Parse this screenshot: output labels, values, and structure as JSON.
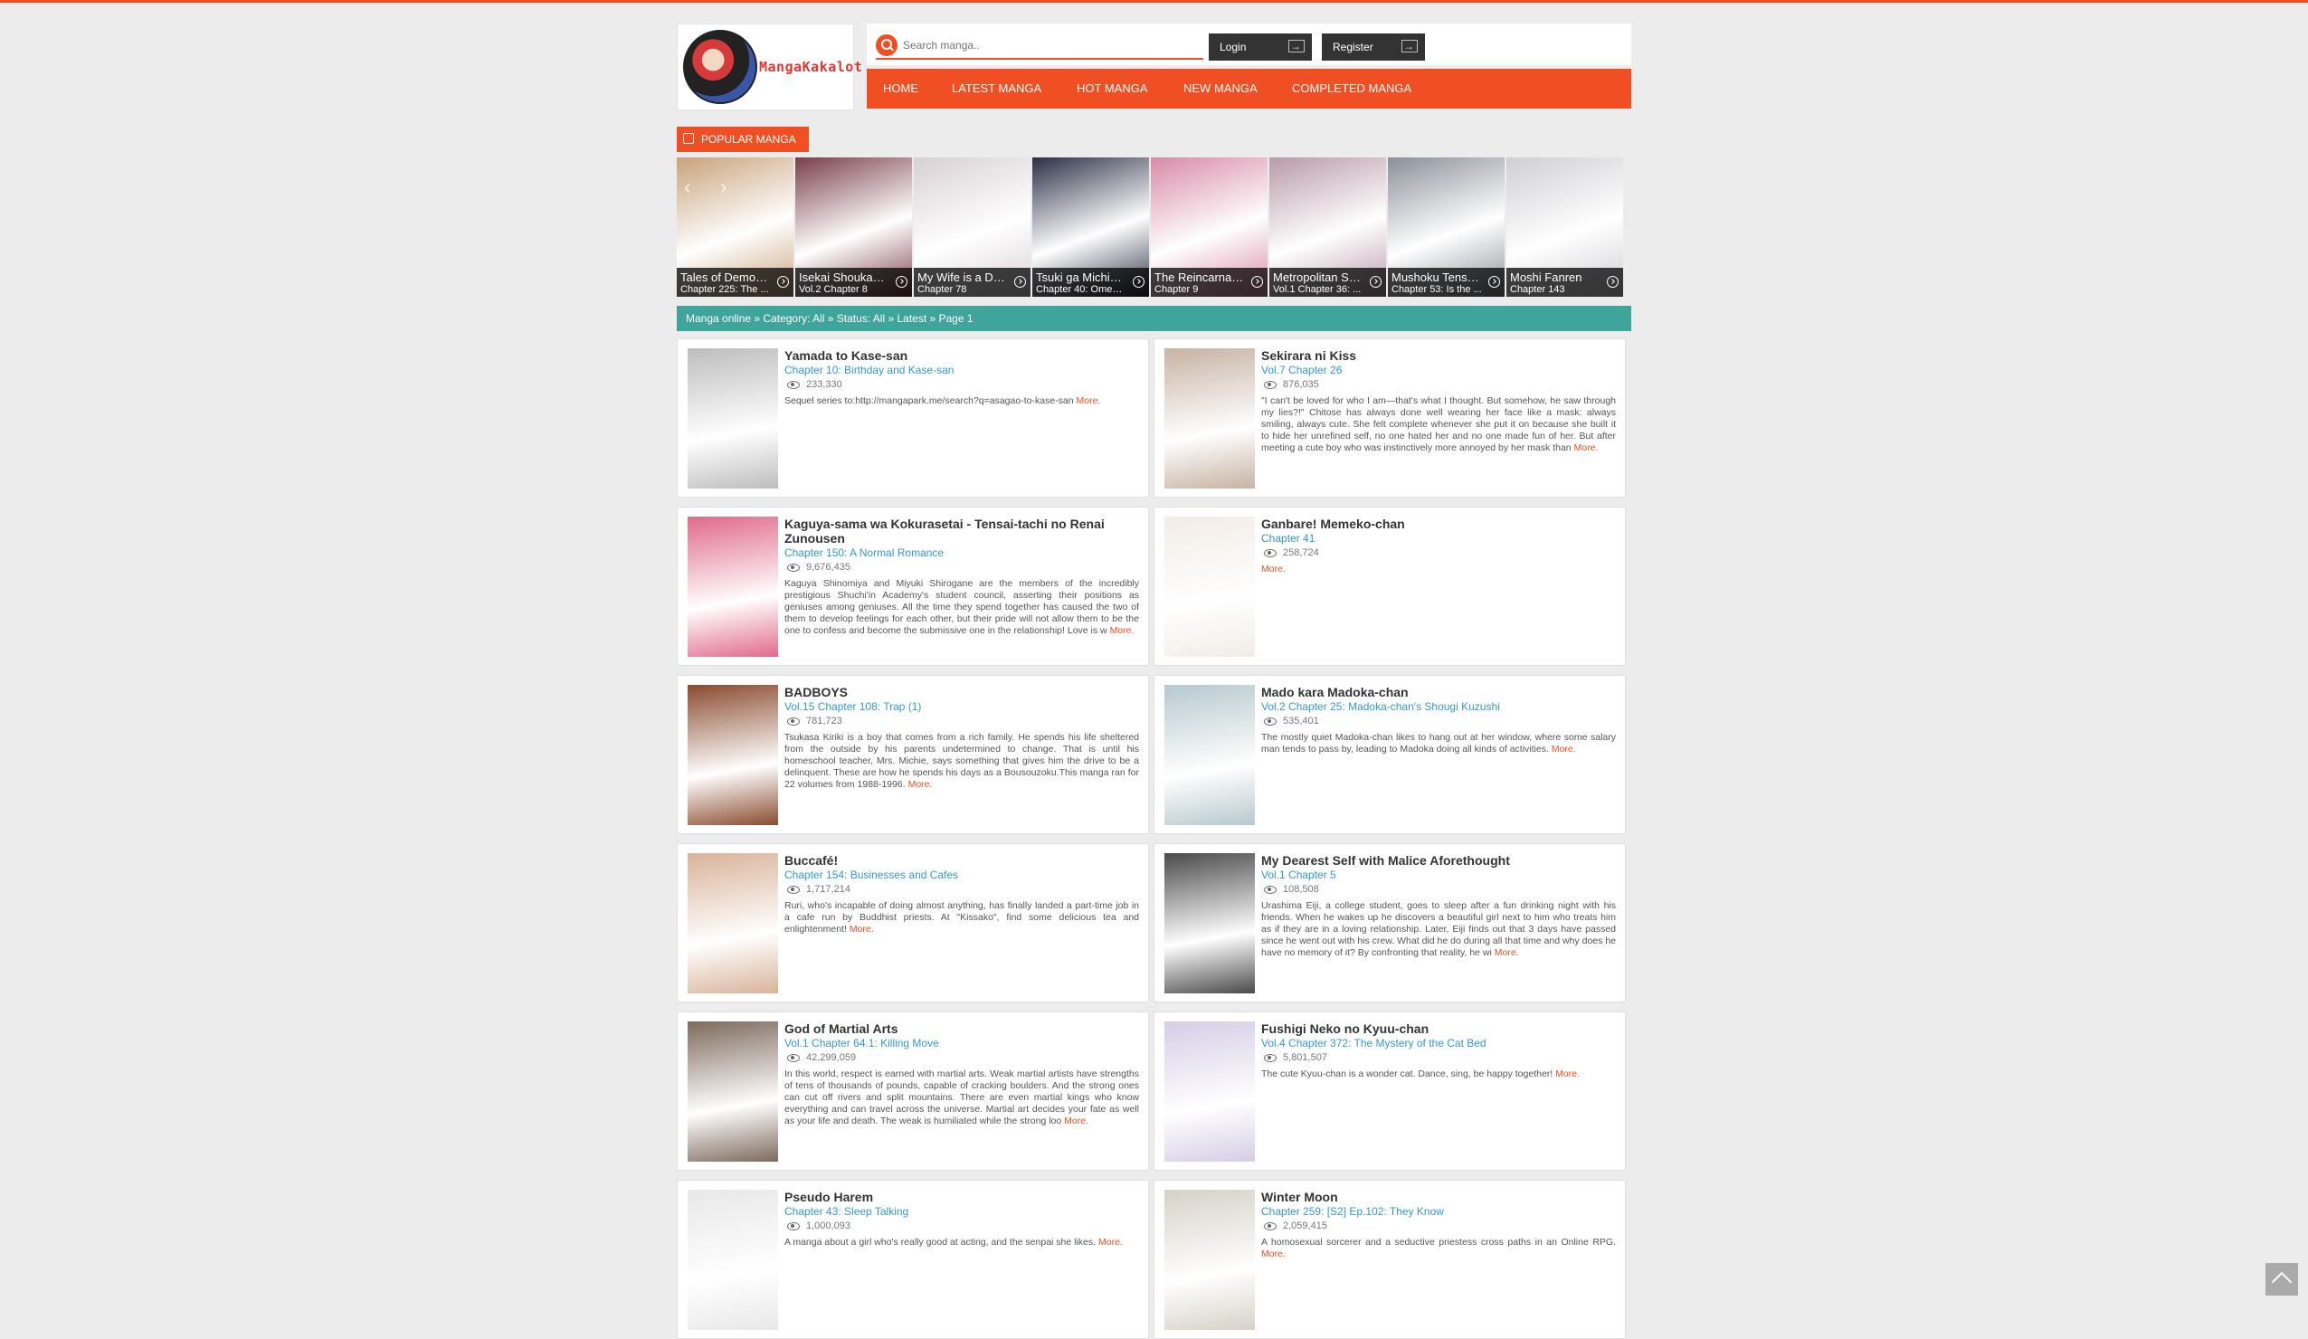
{
  "logo": {
    "text": "MangaKakalot"
  },
  "search": {
    "placeholder": "Search manga.."
  },
  "auth": {
    "login": "Login",
    "register": "Register"
  },
  "nav": [
    "HOME",
    "LATEST MANGA",
    "HOT MANGA",
    "NEW MANGA",
    "COMPLETED MANGA"
  ],
  "popular": {
    "title": "POPULAR MANGA",
    "items": [
      {
        "title": "Tales of Demon...",
        "chapter": "Chapter 225: The ...",
        "color": "#c9a27a"
      },
      {
        "title": "Isekai Shoukan ...",
        "chapter": "Vol.2 Chapter 8",
        "color": "#7a3f4a"
      },
      {
        "title": "My Wife is a De...",
        "chapter": "Chapter 78",
        "color": "#d8d0d4"
      },
      {
        "title": "Tsuki ga Michibi...",
        "chapter": "Chapter 40: Omen ...",
        "color": "#2b2f45"
      },
      {
        "title": "The Reincarnati...",
        "chapter": "Chapter 9",
        "color": "#d88aa6"
      },
      {
        "title": "Metropolitan Sy...",
        "chapter": "Vol.1 Chapter 36: ...",
        "color": "#b89aa8"
      },
      {
        "title": "Mushoku Tensei:...",
        "chapter": "Chapter 53: Is the ...",
        "color": "#8a8f99"
      },
      {
        "title": "Moshi Fanren",
        "chapter": "Chapter 143",
        "color": "#cfcfd4"
      }
    ]
  },
  "breadcrumb": "Manga online » Category: All » Status: All » Latest » Page 1",
  "manga": [
    {
      "title": "Yamada to Kase-san",
      "chapter": "Chapter 10: Birthday and Kase-san",
      "views": "233,330",
      "desc": "Sequel series to:http://mangapark.me/search?q=asagao-to-kase-san",
      "more": "More.",
      "cover": "#bdbdbd"
    },
    {
      "title": "Sekirara ni Kiss",
      "chapter": "Vol.7 Chapter 26",
      "views": "876,035",
      "desc": "\"I can't be loved for who I am—that's what I thought. But somehow, he saw through my lies?!\" Chitose has always done well wearing her face like a mask: always smiling, always cute. She felt complete whenever she put it on because she built it to hide her unrefined self, no one hated her and no one made fun of her. But after meeting a cute boy who was instinctively more annoyed by her mask than",
      "more": "More.",
      "cover": "#c7b3a3"
    },
    {
      "title": "Kaguya-sama wa Kokurasetai - Tensai-tachi no Renai Zunousen",
      "chapter": "Chapter 150: A Normal Romance",
      "views": "9,676,435",
      "desc": "Kaguya Shinomiya and Miyuki Shirogane are the members of the incredibly prestigious Shuchi'in Academy's student council, asserting their positions as geniuses among geniuses. All the time they spend together has caused the two of them to develop feelings for each other, but their pride will not allow them to be the one to confess and become the submissive one in the relationship! Love is w",
      "more": "More.",
      "cover": "#e06a8a"
    },
    {
      "title": "Ganbare! Memeko-chan",
      "chapter": "Chapter 41",
      "views": "258,724",
      "desc": "",
      "more": "More.",
      "cover": "#f2ece6"
    },
    {
      "title": "BADBOYS",
      "chapter": "Vol.15 Chapter 108: Trap (1)",
      "views": "781,723",
      "desc": "Tsukasa Kiriki is a boy that comes from a rich family. He spends his life sheltered from the outside by his parents undetermined to change. That is until his homeschool teacher, Mrs. Michie, says something that gives him the drive to be a delinquent. These are how he spends his days as a Bousouzoku.This manga ran for 22 volumes from 1988-1996.",
      "more": "More.",
      "cover": "#8a4b2f"
    },
    {
      "title": "Mado kara Madoka-chan",
      "chapter": "Vol.2 Chapter 25: Madoka-chan's Shougi Kuzushi",
      "views": "535,401",
      "desc": "The mostly quiet Madoka-chan likes to hang out at her window, where some salary man tends to pass by, leading to Madoka doing all kinds of activities.",
      "more": "More.",
      "cover": "#b7c9cf"
    },
    {
      "title": "Buccafé!",
      "chapter": "Chapter 154: Businesses and Cafes",
      "views": "1,717,214",
      "desc": "Ruri, who's incapable of doing almost anything, has finally landed a part-time job in a cafe run by Buddhist priests. At \"Kissako\", find some delicious tea and enlightenment!",
      "more": "More.",
      "cover": "#d9b39a"
    },
    {
      "title": "My Dearest Self with Malice Aforethought",
      "chapter": "Vol.1 Chapter 5",
      "views": "108,508",
      "desc": "Urashima Eiji, a college student, goes to sleep after a fun drinking night with his friends. When he wakes up he discovers a beautiful girl next to him who treats him as if they are in a loving relationship. Later, Eiji finds out that 3 days have passed since he went out with his crew. What did he do during all that time and why does he have no memory of it? By confronting that reality, he wi",
      "more": "More.",
      "cover": "#4a4a4a"
    },
    {
      "title": "God of Martial Arts",
      "chapter": "Vol.1 Chapter 64.1: Killing Move",
      "views": "42,299,059",
      "desc": "In this world, respect is earned with martial arts. Weak martial artists have strengths of tens of thousands of pounds, capable of cracking boulders. And the strong ones can cut off rivers and split mountains. There are even martial kings who know everything and can travel across the universe. Martial art decides your fate as well as your life and death. The weak is humiliated while the strong loo",
      "more": "More.",
      "cover": "#7d6a5c"
    },
    {
      "title": "Fushigi Neko no Kyuu-chan",
      "chapter": "Vol.4 Chapter 372: The Mystery of the Cat Bed",
      "views": "5,801,507",
      "desc": "The cute Kyuu-chan is a wonder cat. Dance, sing, be happy together!",
      "more": "More.",
      "cover": "#d6cde6"
    },
    {
      "title": "Pseudo Harem",
      "chapter": "Chapter 43: Sleep Talking",
      "views": "1,000,093",
      "desc": "A manga about a girl who's really good at acting, and the senpai she likes.",
      "more": "More.",
      "cover": "#e8e8e8"
    },
    {
      "title": "Winter Moon",
      "chapter": "Chapter 259: [S2] Ep.102: They Know",
      "views": "2,059,415",
      "desc": "A homosexual sorcerer and a seductive priestess cross paths in an Online RPG.",
      "more": "More.",
      "cover": "#d7d2c8"
    }
  ],
  "colors": {
    "accent": "#f04e23",
    "breadcrumb": "#3fa49a",
    "link": "#3399cc"
  }
}
